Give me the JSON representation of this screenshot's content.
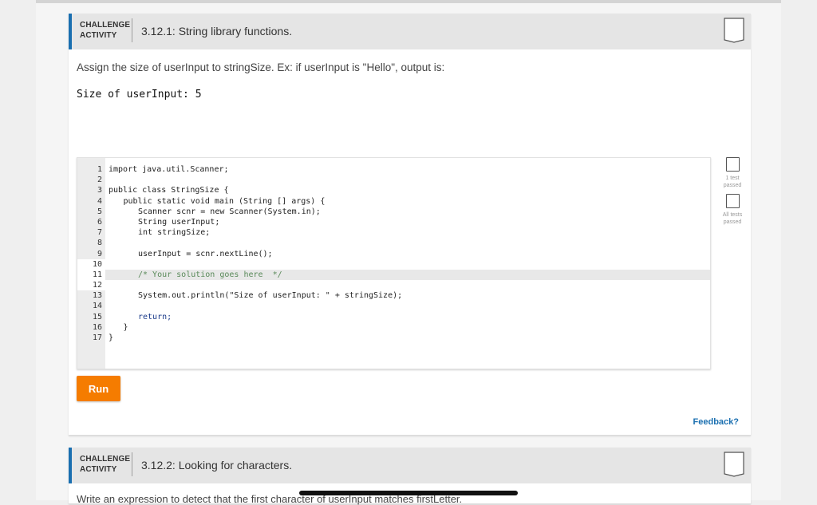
{
  "activity1": {
    "label_line1": "CHALLENGE",
    "label_line2": "ACTIVITY",
    "title": "3.12.1: String library functions.",
    "instructions": "Assign the size of userInput to stringSize. Ex: if userInput is \"Hello\", output is:",
    "example_output": "Size of userInput: 5",
    "line_numbers": [
      "1",
      "2",
      "3",
      "4",
      "5",
      "6",
      "7",
      "8",
      "9",
      "10",
      "11",
      "12",
      "13",
      "14",
      "15",
      "16",
      "17"
    ],
    "code": [
      "import java.util.Scanner;",
      "",
      "public class StringSize {",
      "public static void main (String [] args) {",
      "Scanner scnr = new Scanner(System.in);",
      "String userInput;",
      "int stringSize;",
      "",
      "userInput = scnr.nextLine();",
      "",
      "/* Your solution goes here  */",
      "",
      "System.out.println(\"Size of userInput: \" + stringSize);",
      "",
      "return;",
      "}",
      "}"
    ],
    "tests": [
      {
        "label": "1 test passed"
      },
      {
        "label": "All tests passed"
      }
    ],
    "run_label": "Run",
    "feedback_label": "Feedback?"
  },
  "activity2": {
    "label_line1": "CHALLENGE",
    "label_line2": "ACTIVITY",
    "title": "3.12.2: Looking for characters.",
    "instructions": "Write an expression to detect that the first character of userInput matches firstLetter."
  },
  "icons": {
    "bookmark": "bookmark-icon",
    "checkbox": "test-checkbox-icon"
  },
  "colors": {
    "accent": "#1a6fb0",
    "run_button": "#f57c00"
  }
}
